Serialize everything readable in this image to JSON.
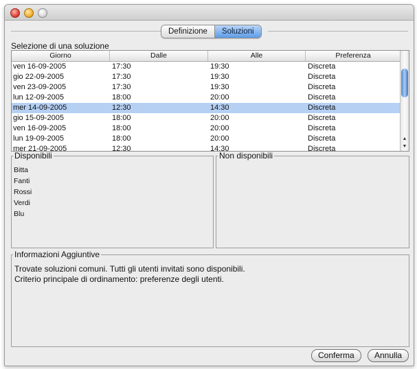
{
  "tabs": [
    {
      "label": "Definizione",
      "active": false
    },
    {
      "label": "Soluzioni",
      "active": true
    }
  ],
  "selection_label": "Selezione di una soluzione",
  "table": {
    "columns": [
      "Giorno",
      "Dalle",
      "Alle",
      "Preferenza"
    ],
    "rows": [
      [
        "ven 16-09-2005",
        "17:30",
        "19:30",
        "Discreta"
      ],
      [
        "gio 22-09-2005",
        "17:30",
        "19:30",
        "Discreta"
      ],
      [
        "ven 23-09-2005",
        "17:30",
        "19:30",
        "Discreta"
      ],
      [
        "lun 12-09-2005",
        "18:00",
        "20:00",
        "Discreta"
      ],
      [
        "mer 14-09-2005",
        "12:30",
        "14:30",
        "Discreta"
      ],
      [
        "gio 15-09-2005",
        "18:00",
        "20:00",
        "Discreta"
      ],
      [
        "ven 16-09-2005",
        "18:00",
        "20:00",
        "Discreta"
      ],
      [
        "lun 19-09-2005",
        "18:00",
        "20:00",
        "Discreta"
      ],
      [
        "mer 21-09-2005",
        "12:30",
        "14:30",
        "Discreta"
      ]
    ],
    "selected_index": 4
  },
  "available": {
    "title": "Disponibili",
    "users": [
      "Bitta",
      "Fanti",
      "Rossi",
      "Verdi",
      "Blu"
    ]
  },
  "unavailable": {
    "title": "Non disponibili"
  },
  "info": {
    "title": "Informazioni Aggiuntive",
    "line1": "Trovate soluzioni comuni. Tutti gli utenti invitati sono disponibili.",
    "line2": "Criterio principale di ordinamento: preferenze degli utenti."
  },
  "buttons": {
    "confirm": "Conferma",
    "cancel": "Annulla"
  },
  "icons": {
    "scroll_up": "scroll-up-arrow-icon",
    "scroll_down": "scroll-down-arrow-icon"
  },
  "colors": {
    "selection": "#b5d0f3",
    "accent": "#5d9be6",
    "close": "#e0443a",
    "minimize": "#f3b130"
  }
}
